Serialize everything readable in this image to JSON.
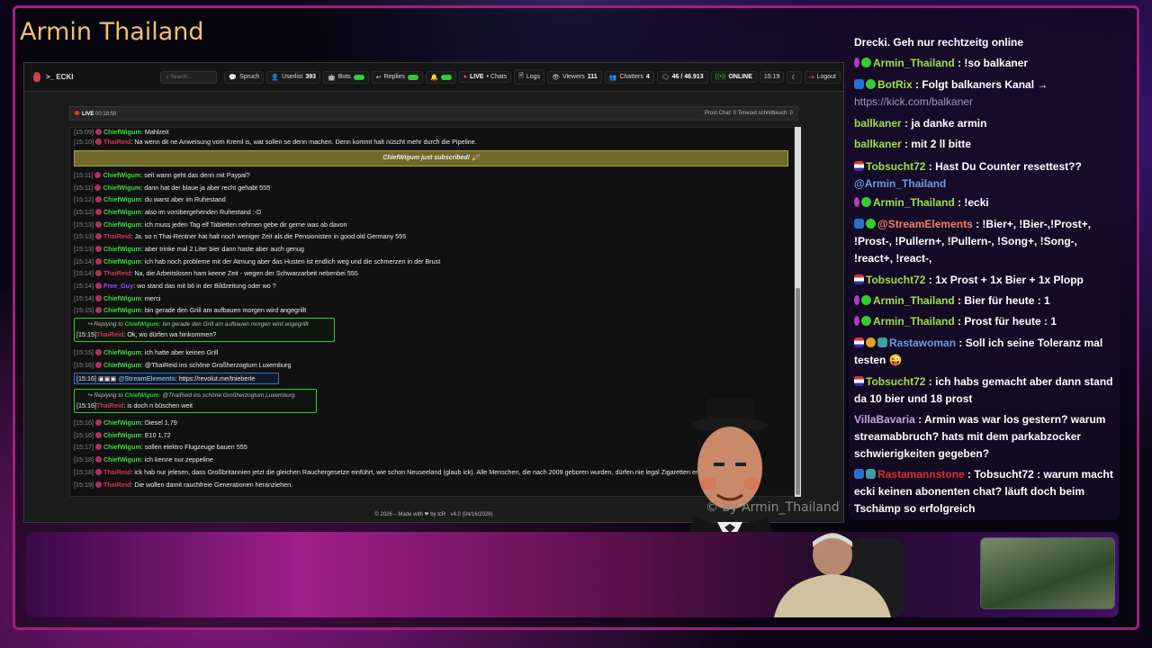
{
  "stream_title": "Armin Thailand",
  "watermark": "© by Armin_Thailand",
  "app": {
    "brand": ">_ ECKI",
    "search_placeholder": "Search...",
    "buttons": {
      "spruch": "Spruch",
      "userlist": "Userlist",
      "userlist_count": "393",
      "bots": "Bots",
      "replies": "Replies",
      "live": "LIVE",
      "chats": "• Chats",
      "logs": "Logs",
      "viewers": "Viewers",
      "viewers_count": "111",
      "chatters": "Chatters",
      "chatters_count": "4",
      "messages": "46 / 46.913",
      "online": "ONLINE",
      "time": "15:19",
      "logout": "Logout"
    },
    "live_bar": {
      "label": "LIVE",
      "time": "00:18:58",
      "right": "Prost Chat: 0   Timeout schnittlauch: 0"
    },
    "footer": "© 2026 – Made with ❤ by tcR · v4.0 (04/16/2026)"
  },
  "chat": [
    {
      "time": "[15:09]",
      "user": "ChiefWigum",
      "cls": "g",
      "text": ": Mahlzeit"
    },
    {
      "time": "[15:10]",
      "user": "ThaiReid",
      "cls": "r",
      "text": ": Na wenn dit ne Anweisung vom Kreml is, wat sollen se denn machen. Denn kommt halt nüscht mehr durch die Pipeline."
    },
    {
      "time": "[15:11]",
      "user": "ChiefWigum",
      "cls": "g",
      "text": ": seit wann geht das denn mit Paypal?"
    },
    {
      "time": "[15:11]",
      "user": "ChiefWigum",
      "cls": "g",
      "text": ": dann hat der blaue ja aber recht gehabt 555"
    },
    {
      "time": "[15:12]",
      "user": "ChiefWigum",
      "cls": "g",
      "text": ": du warst aber im Ruhestand"
    },
    {
      "time": "[15:12]",
      "user": "ChiefWigum",
      "cls": "g",
      "text": ": also im vorübergehenden Ruhestand :-D"
    },
    {
      "time": "[15:13]",
      "user": "ChiefWigum",
      "cls": "g",
      "text": ": ich muss jeden Tag elf Tabletten nehmen gebe dir gerne was ab davon"
    },
    {
      "time": "[15:13]",
      "user": "ThaiReid",
      "cls": "r",
      "text": ": Ja. so n Thai-Rentner hat halt noch weniger Zeit als die Pensionisten in good old Germany 555"
    },
    {
      "time": "[15:13]",
      "user": "ChiefWigum",
      "cls": "g",
      "text": ": aber trinke mal 2 Liter bier dann haste aber auch genug"
    },
    {
      "time": "[15:14]",
      "user": "ChiefWigum",
      "cls": "g",
      "text": ": ich hab noch probleme mit der Atmung aber das Husten ist endlich weg und die schmerzen in der Brust"
    },
    {
      "time": "[15:14]",
      "user": "ThaiReid",
      "cls": "r",
      "text": ": Na, die Arbeitslosen ham keene Zeit - wegen der Schwarzarbeit nebenbei 555"
    },
    {
      "time": "[15:14]",
      "user": "Free_Guy",
      "cls": "p",
      "text": ": wo stand das mit b6 in der Bildzeitung oder wo ?"
    },
    {
      "time": "[15:14]",
      "user": "ChiefWigum",
      "cls": "g",
      "text": ": merci"
    },
    {
      "time": "[15:15]",
      "user": "ChiefWigum",
      "cls": "g",
      "text": ": bin gerade den Grill am aufbauen morgen wird angegrillt"
    },
    {
      "time": "[15:15]",
      "user": "ChiefWigum",
      "cls": "g",
      "text": ": ich hatte aber keinen Grill"
    },
    {
      "time": "[15:16]",
      "user": "ChiefWigum",
      "cls": "g",
      "text": ": @ThaiReid ins schöne Großherzogtum Luxemburg"
    },
    {
      "time": "[15:16]",
      "user": "ChiefWigum",
      "cls": "g",
      "text": ": Diesel 1,79"
    },
    {
      "time": "[15:16]",
      "user": "ChiefWigum",
      "cls": "g",
      "text": ": E10 1,72"
    },
    {
      "time": "[15:17]",
      "user": "ChiefWigum",
      "cls": "g",
      "text": ": sollen elektro Flugzeuge bauen 555"
    },
    {
      "time": "[15:18]",
      "user": "ChiefWigum",
      "cls": "g",
      "text": ": ich kenne nur zeppeline"
    },
    {
      "time": "[15:18]",
      "user": "ThaiReid",
      "cls": "r",
      "text": ": ick hab nur jelesen, dass Großbritannien jetzt die gleichen Rauchergesetze einführt, wie schon Neuseeland (glaub ick). Alle Menschen, die nach 2009 geboren wurden, dürfen nie legal Zigaretten erwerben."
    },
    {
      "time": "[15:19]",
      "user": "ThaiReid",
      "cls": "r",
      "text": ": Die wollen damit rauchfreie Generationen heranziehen."
    }
  ],
  "sub_banner": "ChiefWigum just subscribed! 🎉",
  "reply1": {
    "label": "↪ Replying to",
    "target": "ChiefWigum:",
    "quote": "bin gerade den Grill am aufbauen morgen wird angegrillt",
    "time": "[15:15]",
    "user": "ThaiReid",
    "text": ": Ok, wo dürfen wa hinkommen?"
  },
  "se_line": {
    "time": "[15:16]",
    "user": "@StreamElements",
    "text": ": https://revolut.me/tnieberle"
  },
  "reply2": {
    "label": "↪ Replying to",
    "target": "ChiefWigum:",
    "quote": "@ThaiReid ins schöne Großherzogtum Luxemburg",
    "time": "[15:16]",
    "user": "ThaiReid",
    "text": ": is doch n büschen weit"
  },
  "side_chat": [
    {
      "badges": [],
      "user": "",
      "text": "Drecki. Geh nur rechtzeitg online"
    },
    {
      "badges": [
        "mic",
        "ok"
      ],
      "user": "Armin_Thailand",
      "cls": "u",
      "text": " : !so balkaner"
    },
    {
      "badges": [
        "bot",
        "ok"
      ],
      "user": "BotRix",
      "cls": "u",
      "text": " : Folgt balkaners Kanal →",
      "link": "https://kick.com/balkaner"
    },
    {
      "badges": [],
      "user": "ballkaner",
      "cls": "u",
      "text": " : ja danke armin"
    },
    {
      "badges": [],
      "user": "ballkaner",
      "cls": "u",
      "text": " : mit 2 ll bitte"
    },
    {
      "badges": [
        "flag"
      ],
      "user": "Tobsucht72",
      "cls": "u",
      "text": " : Hast Du Counter resettest??",
      "mention": "@Armin_Thailand"
    },
    {
      "badges": [
        "mic",
        "ok"
      ],
      "user": "Armin_Thailand",
      "cls": "u",
      "text": " : !ecki"
    },
    {
      "badges": [
        "bot",
        "ok"
      ],
      "user": "@StreamElements",
      "cls": "u2",
      "text": " : !Bier+, !Bier-,!Prost+, !Prost-, !Pullern+, !Pullern-, !Song+, !Song-, !react+, !react-,"
    },
    {
      "badges": [
        "flag"
      ],
      "user": "Tobsucht72",
      "cls": "u",
      "text": " : 1x Prost + 1x Bier + 1x Plopp"
    },
    {
      "badges": [
        "mic",
        "ok"
      ],
      "user": "Armin_Thailand",
      "cls": "u",
      "text": " : Bier für heute : 1"
    },
    {
      "badges": [
        "mic",
        "ok"
      ],
      "user": "Armin_Thailand",
      "cls": "u",
      "text": " : Prost für heute : 1"
    },
    {
      "badges": [
        "flag",
        "gold",
        "tw"
      ],
      "user": "Rastawoman",
      "cls": "u4",
      "text": " : Soll ich seine Toleranz mal testen 😜"
    },
    {
      "badges": [
        "flag"
      ],
      "user": "Tobsucht72",
      "cls": "u",
      "text": " : ich habs gemacht aber dann stand da 10 bier und 18 prost"
    },
    {
      "badges": [],
      "user": "VillaBavaria",
      "cls": "u3",
      "text": " : Armin was war los gestern? warum streamabbruch? hats mit dem parkabzocker schwierigkeiten gegeben?"
    },
    {
      "badges": [
        "bot",
        "tw"
      ],
      "user": "Rastamannstone",
      "cls": "u5",
      "text": " : Tobsucht72 : warum macht ecki keinen abonenten chat? läuft doch beim Tschämp so erfolgreich"
    }
  ]
}
